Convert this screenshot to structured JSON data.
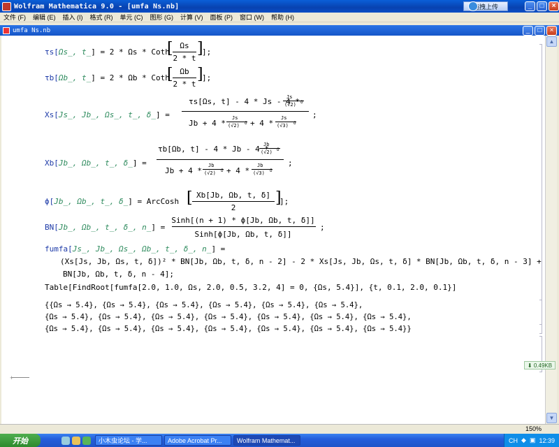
{
  "window": {
    "title": "Wolfram Mathematica 9.0 - [umfa Ns.nb]",
    "upload_button": "拖拽上传",
    "controls": {
      "minimize": "_",
      "maximize": "□",
      "close": "×"
    }
  },
  "menu": [
    "文件 (F)",
    "编辑 (E)",
    "插入 (I)",
    "格式 (R)",
    "单元 (C)",
    "图形 (G)",
    "计算 (V)",
    "面板 (P)",
    "窗口 (W)",
    "帮助 (H)"
  ],
  "notebook": {
    "title": "umfa Ns.nb"
  },
  "code": {
    "l1_lhs_a": "τs[",
    "l1_lhs_b": "Ωs_, t_",
    "l1_lhs_c": "] = 2 * Ωs * Coth",
    "l1_num": "Ωs",
    "l1_den": "2 * t",
    "l1_end": "];",
    "l2_lhs_a": "τb[",
    "l2_lhs_b": "Ωb_, t_",
    "l2_lhs_c": "] = 2 * Ωb * Coth",
    "l2_num": "Ωb",
    "l2_den": "2 * t",
    "l2_end": "];",
    "l3_lhs_a": "Xs[",
    "l3_lhs_b": "Js_, Jb_, Ωs_, t_, δ_",
    "l3_lhs_c": "] =",
    "l3_num_a": "τs[Ωs, t] - 4 * Js - 4 *",
    "l3_num_fn": "Js",
    "l3_num_fd": "(√2)",
    "l3_num_exp": "δ",
    "l3_den_a": "Jb + 4 *",
    "l3_den_fn1": "Js",
    "l3_den_fd1": "(√2)",
    "l3_den_exp1": "δ",
    "l3_den_b": "+ 4 *",
    "l3_den_fn2": "Js",
    "l3_den_fd2": "(√3)",
    "l3_den_exp2": "δ",
    "l3_end": ";",
    "l4_lhs_a": "Xb[",
    "l4_lhs_b": "Jb_, Ωb_, t_, δ_",
    "l4_lhs_c": "] =",
    "l4_num_a": "τb[Ωb, t] - 4 * Jb - 4 *",
    "l4_num_fn": "Jb",
    "l4_num_fd": "(√2)",
    "l4_num_exp": "δ",
    "l4_den_a": "Jb + 4 *",
    "l4_den_fn1": "Jb",
    "l4_den_fd1": "(√2)",
    "l4_den_exp1": "δ",
    "l4_den_b": "+ 4 *",
    "l4_den_fn2": "Jb",
    "l4_den_fd2": "(√3)",
    "l4_den_exp2": "δ",
    "l4_end": ";",
    "l5_lhs_a": "ϕ[",
    "l5_lhs_b": "Jb_, Ωb_, t_, δ_",
    "l5_lhs_c": "] = ArcCosh",
    "l5_num": "Xb[Jb, Ωb, t, δ]",
    "l5_den": "2",
    "l5_end": "];",
    "l6_lhs_a": "BN[",
    "l6_lhs_b": "Jb_, Ωb_, t_, δ_, n_",
    "l6_lhs_c": "] =",
    "l6_num": "Sinh[(n + 1) * ϕ[Jb, Ωb, t, δ]]",
    "l6_den": "Sinh[ϕ[Jb, Ωb, t, δ]]",
    "l6_end": ";",
    "l7_a": "fumfa[",
    "l7_b": "Js_, Jb_, Ωs_, Ωb_, t_, δ_, n_",
    "l7_c": "] =",
    "l8": "(Xs[Js, Jb, Ωs, t, δ])² * BN[Jb, Ωb, t, δ, n - 2] - 2 * Xs[Js, Jb, Ωs, t, δ] * BN[Jb, Ωb, t, δ, n - 3] +",
    "l9": "BN[Jb, Ωb, t, δ, n - 4];",
    "l10": "Table[FindRoot[fumfa[2.0, 1.0, Ωs, 2.0, 0.5, 3.2, 4] = 0, {Ωs, 5.4}], {t, 0.1, 2.0, 0.1}]"
  },
  "output": {
    "line1": "{{Ωs → 5.4}, {Ωs → 5.4}, {Ωs → 5.4}, {Ωs → 5.4}, {Ωs → 5.4}, {Ωs → 5.4},",
    "line2": " {Ωs → 5.4}, {Ωs → 5.4}, {Ωs → 5.4}, {Ωs → 5.4}, {Ωs → 5.4}, {Ωs → 5.4}, {Ωs → 5.4},",
    "line3": " {Ωs → 5.4}, {Ωs → 5.4}, {Ωs → 5.4}, {Ωs → 5.4}, {Ωs → 5.4}, {Ωs → 5.4}, {Ωs → 5.4}}"
  },
  "status": {
    "zoom": "150%",
    "download": "0.49KB"
  },
  "taskbar": {
    "start": "开始",
    "tasks": [
      "小木虫论坛 - 学...",
      "Adobe Acrobat Pr...",
      "Wolfram Mathemat..."
    ],
    "lang": "CH",
    "clock": "12:39"
  }
}
